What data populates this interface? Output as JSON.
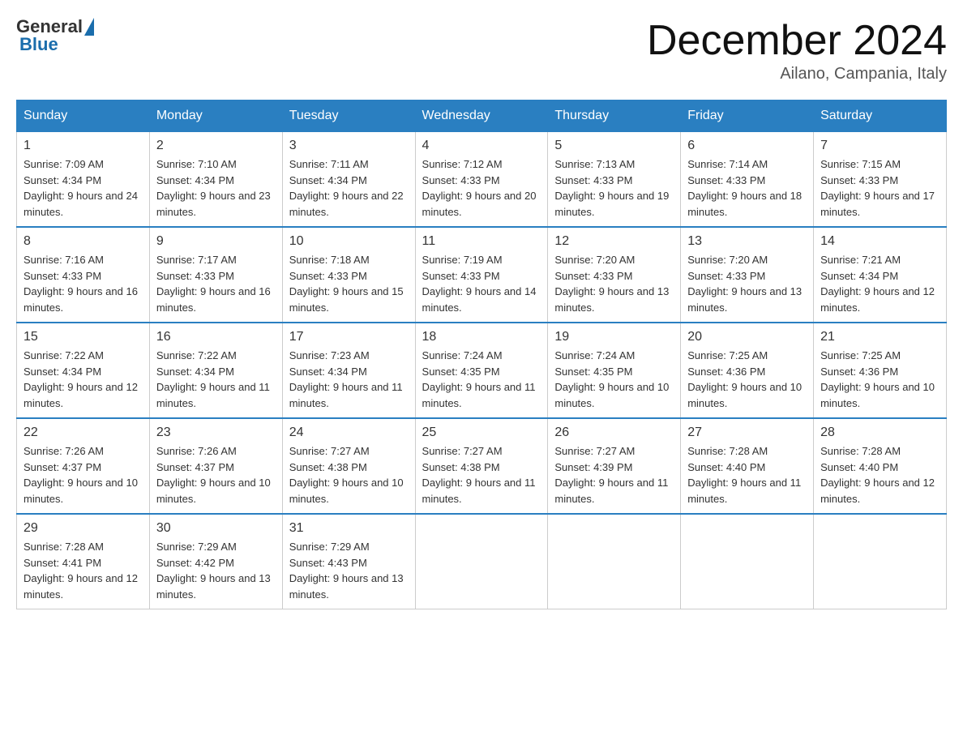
{
  "header": {
    "logo_general": "General",
    "logo_blue": "Blue",
    "month_title": "December 2024",
    "location": "Ailano, Campania, Italy"
  },
  "days_of_week": [
    "Sunday",
    "Monday",
    "Tuesday",
    "Wednesday",
    "Thursday",
    "Friday",
    "Saturday"
  ],
  "weeks": [
    [
      {
        "day": "1",
        "sunrise": "Sunrise: 7:09 AM",
        "sunset": "Sunset: 4:34 PM",
        "daylight": "Daylight: 9 hours and 24 minutes."
      },
      {
        "day": "2",
        "sunrise": "Sunrise: 7:10 AM",
        "sunset": "Sunset: 4:34 PM",
        "daylight": "Daylight: 9 hours and 23 minutes."
      },
      {
        "day": "3",
        "sunrise": "Sunrise: 7:11 AM",
        "sunset": "Sunset: 4:34 PM",
        "daylight": "Daylight: 9 hours and 22 minutes."
      },
      {
        "day": "4",
        "sunrise": "Sunrise: 7:12 AM",
        "sunset": "Sunset: 4:33 PM",
        "daylight": "Daylight: 9 hours and 20 minutes."
      },
      {
        "day": "5",
        "sunrise": "Sunrise: 7:13 AM",
        "sunset": "Sunset: 4:33 PM",
        "daylight": "Daylight: 9 hours and 19 minutes."
      },
      {
        "day": "6",
        "sunrise": "Sunrise: 7:14 AM",
        "sunset": "Sunset: 4:33 PM",
        "daylight": "Daylight: 9 hours and 18 minutes."
      },
      {
        "day": "7",
        "sunrise": "Sunrise: 7:15 AM",
        "sunset": "Sunset: 4:33 PM",
        "daylight": "Daylight: 9 hours and 17 minutes."
      }
    ],
    [
      {
        "day": "8",
        "sunrise": "Sunrise: 7:16 AM",
        "sunset": "Sunset: 4:33 PM",
        "daylight": "Daylight: 9 hours and 16 minutes."
      },
      {
        "day": "9",
        "sunrise": "Sunrise: 7:17 AM",
        "sunset": "Sunset: 4:33 PM",
        "daylight": "Daylight: 9 hours and 16 minutes."
      },
      {
        "day": "10",
        "sunrise": "Sunrise: 7:18 AM",
        "sunset": "Sunset: 4:33 PM",
        "daylight": "Daylight: 9 hours and 15 minutes."
      },
      {
        "day": "11",
        "sunrise": "Sunrise: 7:19 AM",
        "sunset": "Sunset: 4:33 PM",
        "daylight": "Daylight: 9 hours and 14 minutes."
      },
      {
        "day": "12",
        "sunrise": "Sunrise: 7:20 AM",
        "sunset": "Sunset: 4:33 PM",
        "daylight": "Daylight: 9 hours and 13 minutes."
      },
      {
        "day": "13",
        "sunrise": "Sunrise: 7:20 AM",
        "sunset": "Sunset: 4:33 PM",
        "daylight": "Daylight: 9 hours and 13 minutes."
      },
      {
        "day": "14",
        "sunrise": "Sunrise: 7:21 AM",
        "sunset": "Sunset: 4:34 PM",
        "daylight": "Daylight: 9 hours and 12 minutes."
      }
    ],
    [
      {
        "day": "15",
        "sunrise": "Sunrise: 7:22 AM",
        "sunset": "Sunset: 4:34 PM",
        "daylight": "Daylight: 9 hours and 12 minutes."
      },
      {
        "day": "16",
        "sunrise": "Sunrise: 7:22 AM",
        "sunset": "Sunset: 4:34 PM",
        "daylight": "Daylight: 9 hours and 11 minutes."
      },
      {
        "day": "17",
        "sunrise": "Sunrise: 7:23 AM",
        "sunset": "Sunset: 4:34 PM",
        "daylight": "Daylight: 9 hours and 11 minutes."
      },
      {
        "day": "18",
        "sunrise": "Sunrise: 7:24 AM",
        "sunset": "Sunset: 4:35 PM",
        "daylight": "Daylight: 9 hours and 11 minutes."
      },
      {
        "day": "19",
        "sunrise": "Sunrise: 7:24 AM",
        "sunset": "Sunset: 4:35 PM",
        "daylight": "Daylight: 9 hours and 10 minutes."
      },
      {
        "day": "20",
        "sunrise": "Sunrise: 7:25 AM",
        "sunset": "Sunset: 4:36 PM",
        "daylight": "Daylight: 9 hours and 10 minutes."
      },
      {
        "day": "21",
        "sunrise": "Sunrise: 7:25 AM",
        "sunset": "Sunset: 4:36 PM",
        "daylight": "Daylight: 9 hours and 10 minutes."
      }
    ],
    [
      {
        "day": "22",
        "sunrise": "Sunrise: 7:26 AM",
        "sunset": "Sunset: 4:37 PM",
        "daylight": "Daylight: 9 hours and 10 minutes."
      },
      {
        "day": "23",
        "sunrise": "Sunrise: 7:26 AM",
        "sunset": "Sunset: 4:37 PM",
        "daylight": "Daylight: 9 hours and 10 minutes."
      },
      {
        "day": "24",
        "sunrise": "Sunrise: 7:27 AM",
        "sunset": "Sunset: 4:38 PM",
        "daylight": "Daylight: 9 hours and 10 minutes."
      },
      {
        "day": "25",
        "sunrise": "Sunrise: 7:27 AM",
        "sunset": "Sunset: 4:38 PM",
        "daylight": "Daylight: 9 hours and 11 minutes."
      },
      {
        "day": "26",
        "sunrise": "Sunrise: 7:27 AM",
        "sunset": "Sunset: 4:39 PM",
        "daylight": "Daylight: 9 hours and 11 minutes."
      },
      {
        "day": "27",
        "sunrise": "Sunrise: 7:28 AM",
        "sunset": "Sunset: 4:40 PM",
        "daylight": "Daylight: 9 hours and 11 minutes."
      },
      {
        "day": "28",
        "sunrise": "Sunrise: 7:28 AM",
        "sunset": "Sunset: 4:40 PM",
        "daylight": "Daylight: 9 hours and 12 minutes."
      }
    ],
    [
      {
        "day": "29",
        "sunrise": "Sunrise: 7:28 AM",
        "sunset": "Sunset: 4:41 PM",
        "daylight": "Daylight: 9 hours and 12 minutes."
      },
      {
        "day": "30",
        "sunrise": "Sunrise: 7:29 AM",
        "sunset": "Sunset: 4:42 PM",
        "daylight": "Daylight: 9 hours and 13 minutes."
      },
      {
        "day": "31",
        "sunrise": "Sunrise: 7:29 AM",
        "sunset": "Sunset: 4:43 PM",
        "daylight": "Daylight: 9 hours and 13 minutes."
      },
      null,
      null,
      null,
      null
    ]
  ]
}
